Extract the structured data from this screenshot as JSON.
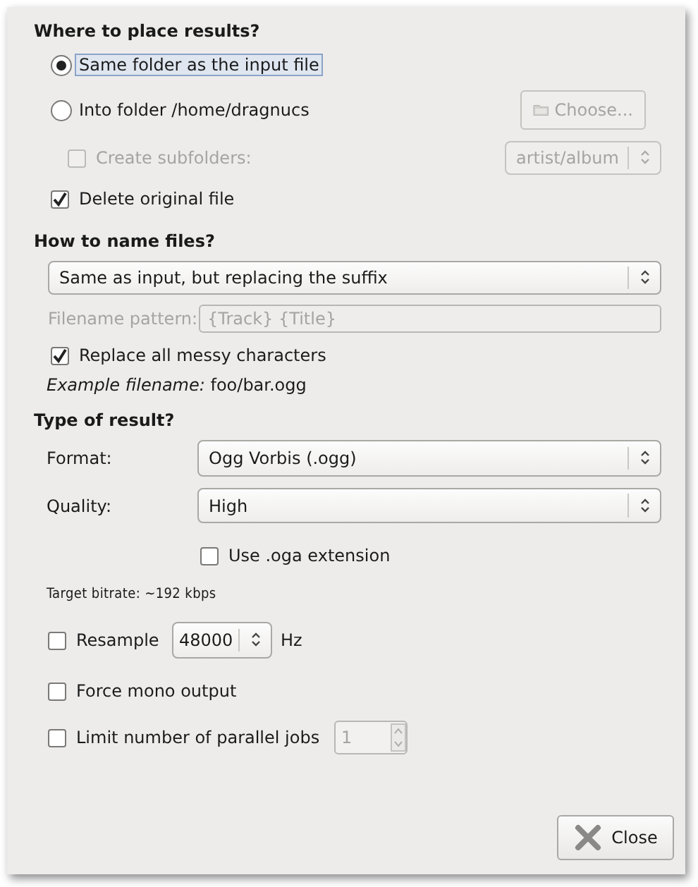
{
  "placement": {
    "title": "Where to place results?",
    "options": [
      {
        "label": "Same folder as the input file",
        "selected": true,
        "focused": true
      },
      {
        "label": "Into folder /home/dragnucs",
        "selected": false,
        "focused": false
      }
    ],
    "choose_button": {
      "label": "Choose...",
      "disabled": true
    },
    "subfolders": {
      "label": "Create subfolders:",
      "checked": false,
      "disabled": true,
      "value": "artist/album"
    },
    "delete_original": {
      "label": "Delete original file",
      "checked": true
    }
  },
  "naming": {
    "title": "How to name files?",
    "scheme": {
      "value": "Same as input, but replacing the suffix"
    },
    "pattern": {
      "label": "Filename pattern:",
      "value": "{Track} {Title}",
      "disabled": true
    },
    "replace_messy": {
      "label": "Replace all messy characters",
      "checked": true
    },
    "example": {
      "label": "Example filename:",
      "value": "foo/bar.ogg"
    }
  },
  "result": {
    "title": "Type of result?",
    "format": {
      "label": "Format:",
      "value": "Ogg Vorbis (.ogg)"
    },
    "quality": {
      "label": "Quality:",
      "value": "High"
    },
    "oga": {
      "label": "Use .oga extension",
      "checked": false
    },
    "target_bitrate": "Target bitrate: ~192 kbps",
    "resample": {
      "label": "Resample",
      "checked": false,
      "value": "48000",
      "unit": "Hz"
    },
    "force_mono": {
      "label": "Force mono output",
      "checked": false
    },
    "limit_jobs": {
      "label": "Limit number of parallel jobs",
      "checked": false,
      "value": "1",
      "disabled": true
    }
  },
  "buttons": [
    {
      "label": "Close",
      "kind": "close"
    }
  ]
}
